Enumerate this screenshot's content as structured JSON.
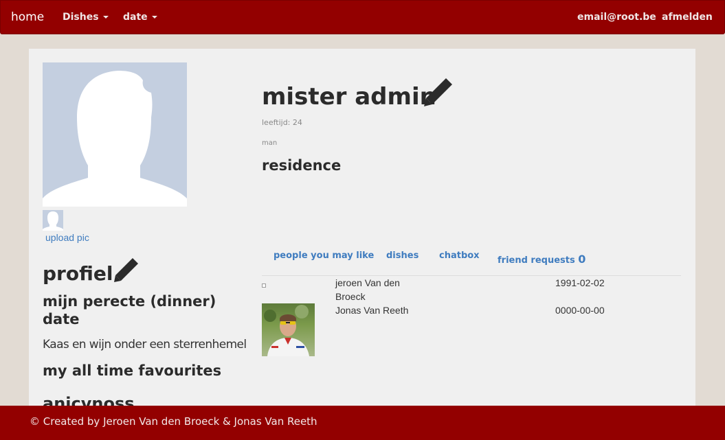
{
  "navbar": {
    "home": "home",
    "dishes": "Dishes",
    "date": "date",
    "email": "email@root.be",
    "logout": "afmelden"
  },
  "profile": {
    "name": "mister admin",
    "age": "leeftijd: 24",
    "gender": "man",
    "residence_heading": "residence",
    "upload_label": "upload pic",
    "profile_heading": "profiel",
    "perfect_date_heading": "mijn perecte (dinner) date",
    "perfect_date_text": "Kaas en wijn onder een sterrenhemel",
    "favourites_heading": "my all time favourites",
    "cut_off_heading": "anicvnoss"
  },
  "tabs": [
    {
      "label": "people you may like"
    },
    {
      "label": "dishes"
    },
    {
      "label": "chatbox"
    },
    {
      "label": "friend requests",
      "count": "0"
    }
  ],
  "people": [
    {
      "name": "jeroen Van den Broeck",
      "date": "1991-02-02"
    },
    {
      "name": "Jonas Van Reeth",
      "date": "0000-00-00"
    }
  ],
  "footer": {
    "text": "© Created by Jeroen Van den Broeck & Jonas Van Reeth"
  },
  "colors": {
    "brand": "#930000",
    "link": "#3f7cbf",
    "background": "#e2dbd3",
    "panel": "#f0f0f0",
    "avatar": "#c4cfe0"
  }
}
